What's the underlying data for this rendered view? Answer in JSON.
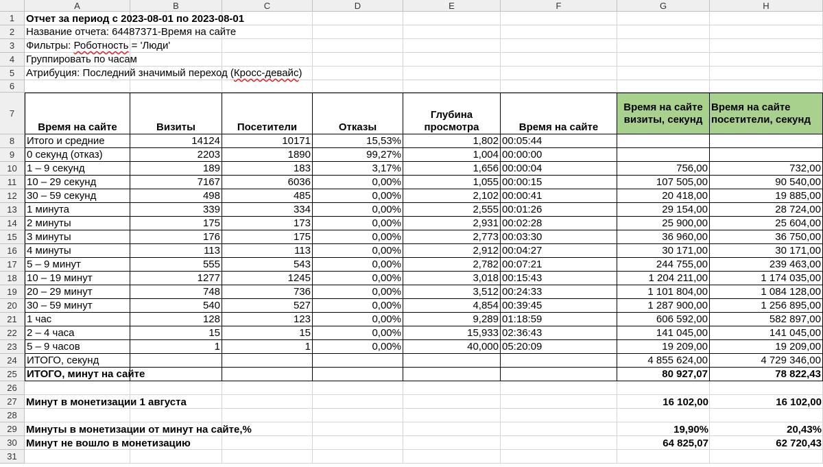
{
  "columns": [
    "A",
    "B",
    "C",
    "D",
    "E",
    "F",
    "G",
    "H"
  ],
  "rows": [
    "1",
    "2",
    "3",
    "4",
    "5",
    "6",
    "7",
    "8",
    "9",
    "10",
    "11",
    "12",
    "13",
    "14",
    "15",
    "16",
    "17",
    "18",
    "19",
    "20",
    "21",
    "22",
    "23",
    "24",
    "25",
    "26",
    "27",
    "28",
    "29",
    "30",
    "31"
  ],
  "info": {
    "title": "Отчет за период с 2023-08-01 по 2023-08-01",
    "report_name": "Название отчета: 64487371-Время на сайте",
    "filters_prefix": "Фильтры: ",
    "filters_underlined": "Роботность",
    "filters_suffix": " = 'Люди'",
    "grouping": "Группировать по часам",
    "attribution_prefix": "Атрибуция: Последний значимый переход (",
    "attribution_underlined": "Кросс-девайс",
    "attribution_suffix": ")"
  },
  "table": {
    "headers": [
      "Время на сайте",
      "Визиты",
      "Посетители",
      "Отказы",
      "Глубина просмотра",
      "Время на сайте",
      "Время на сайте визиты, секунд",
      "Время на сайте посетители, секунд"
    ],
    "rows": [
      [
        "Итого и средние",
        "14124",
        "10171",
        "15,53%",
        "1,802",
        "00:05:44",
        "",
        ""
      ],
      [
        "0 секунд (отказ)",
        "2203",
        "1890",
        "99,27%",
        "1,004",
        "00:00:00",
        "",
        ""
      ],
      [
        "1 – 9 секунд",
        "189",
        "183",
        "3,17%",
        "1,656",
        "00:00:04",
        "756,00",
        "732,00"
      ],
      [
        "10 – 29 секунд",
        "7167",
        "6036",
        "0,00%",
        "1,055",
        "00:00:15",
        "107 505,00",
        "90 540,00"
      ],
      [
        "30 – 59 секунд",
        "498",
        "485",
        "0,00%",
        "2,102",
        "00:00:41",
        "20 418,00",
        "19 885,00"
      ],
      [
        "1 минута",
        "339",
        "334",
        "0,00%",
        "2,555",
        "00:01:26",
        "29 154,00",
        "28 724,00"
      ],
      [
        "2 минуты",
        "175",
        "173",
        "0,00%",
        "2,931",
        "00:02:28",
        "25 900,00",
        "25 604,00"
      ],
      [
        "3 минуты",
        "176",
        "175",
        "0,00%",
        "2,773",
        "00:03:30",
        "36 960,00",
        "36 750,00"
      ],
      [
        "4 минуты",
        "113",
        "113",
        "0,00%",
        "2,912",
        "00:04:27",
        "30 171,00",
        "30 171,00"
      ],
      [
        "5 – 9 минут",
        "555",
        "543",
        "0,00%",
        "2,782",
        "00:07:21",
        "244 755,00",
        "239 463,00"
      ],
      [
        "10 – 19 минут",
        "1277",
        "1245",
        "0,00%",
        "3,018",
        "00:15:43",
        "1 204 211,00",
        "1 174 035,00"
      ],
      [
        "20 – 29 минут",
        "748",
        "736",
        "0,00%",
        "3,512",
        "00:24:33",
        "1 101 804,00",
        "1 084 128,00"
      ],
      [
        "30 – 59 минут",
        "540",
        "527",
        "0,00%",
        "4,854",
        "00:39:45",
        "1 287 900,00",
        "1 256 895,00"
      ],
      [
        "1 час",
        "128",
        "123",
        "0,00%",
        "9,289",
        "01:18:59",
        "606 592,00",
        "582 897,00"
      ],
      [
        "2 – 4 часа",
        "15",
        "15",
        "0,00%",
        "15,933",
        "02:36:43",
        "141 045,00",
        "141 045,00"
      ],
      [
        "5 – 9 часов",
        "1",
        "1",
        "0,00%",
        "40,000",
        "05:20:09",
        "19 209,00",
        "19 209,00"
      ],
      [
        "ИТОГО, секунд",
        "",
        "",
        "",
        "",
        "",
        "4 855 624,00",
        "4 729 346,00"
      ],
      [
        "ИТОГО, минут на сайте",
        "",
        "",
        "",
        "",
        "",
        "80 927,07",
        "78 822,43"
      ]
    ]
  },
  "summary": {
    "monetization_label": "Минут в монетизации 1 августа",
    "monetization_g": "16 102,00",
    "monetization_h": "16 102,00",
    "percent_label": "Минуты в монетизации от минут на сайте,%",
    "percent_g": "19,90%",
    "percent_h": "20,43%",
    "not_in_label": "Минут не вошло в монетизацию",
    "not_in_g": "64 825,07",
    "not_in_h": "62 720,43"
  }
}
